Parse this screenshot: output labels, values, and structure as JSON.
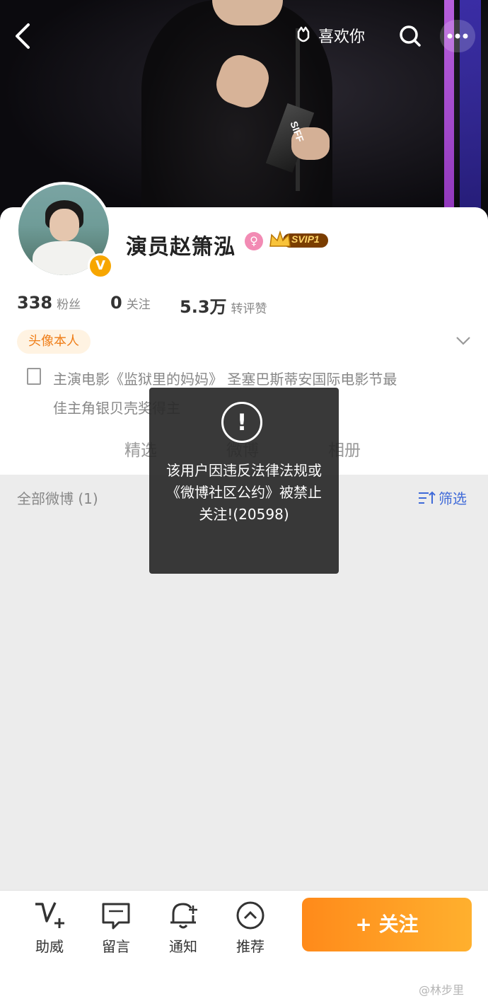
{
  "header": {
    "back_icon": "chevron-left-icon",
    "like_label": "喜欢你",
    "search_icon": "search-icon",
    "more_icon": "more-icon",
    "cover_text": "SIFF"
  },
  "profile": {
    "name": "演员赵箫泓",
    "verified_badge": "V",
    "vip_label": "SVIP1",
    "stats": [
      {
        "value": "338",
        "label": "粉丝"
      },
      {
        "value": "0",
        "label": "关注"
      },
      {
        "value": "5.3万",
        "label": "转评赞"
      }
    ],
    "tag": "头像本人",
    "bio_line1": "主演电影《监狱里的妈妈》 圣塞巴斯蒂安国际电影节最",
    "bio_line2": "佳主角银贝壳奖得主"
  },
  "tabs": [
    {
      "label": "精选"
    },
    {
      "label": "微博"
    },
    {
      "label": "相册"
    }
  ],
  "subbar": {
    "all_weibo": "全部微博 (1)",
    "filter": "筛选"
  },
  "toast": {
    "icon": "!",
    "message": "该用户因违反法律法规或《微博社区公约》被禁止关注!(20598)"
  },
  "bottom_bar": {
    "items": [
      {
        "label": "助威",
        "icon": "v-plus-icon"
      },
      {
        "label": "留言",
        "icon": "message-icon"
      },
      {
        "label": "通知",
        "icon": "bell-plus-icon"
      },
      {
        "label": "推荐",
        "icon": "chevron-up-circle-icon"
      }
    ],
    "follow": "+ 关注"
  },
  "watermark": "@林步里",
  "colors": {
    "accent_orange": "#ff8a1a",
    "tag_orange": "#ef7d17",
    "link_blue": "#3f6ad8",
    "verified_gold": "#f7a600"
  }
}
